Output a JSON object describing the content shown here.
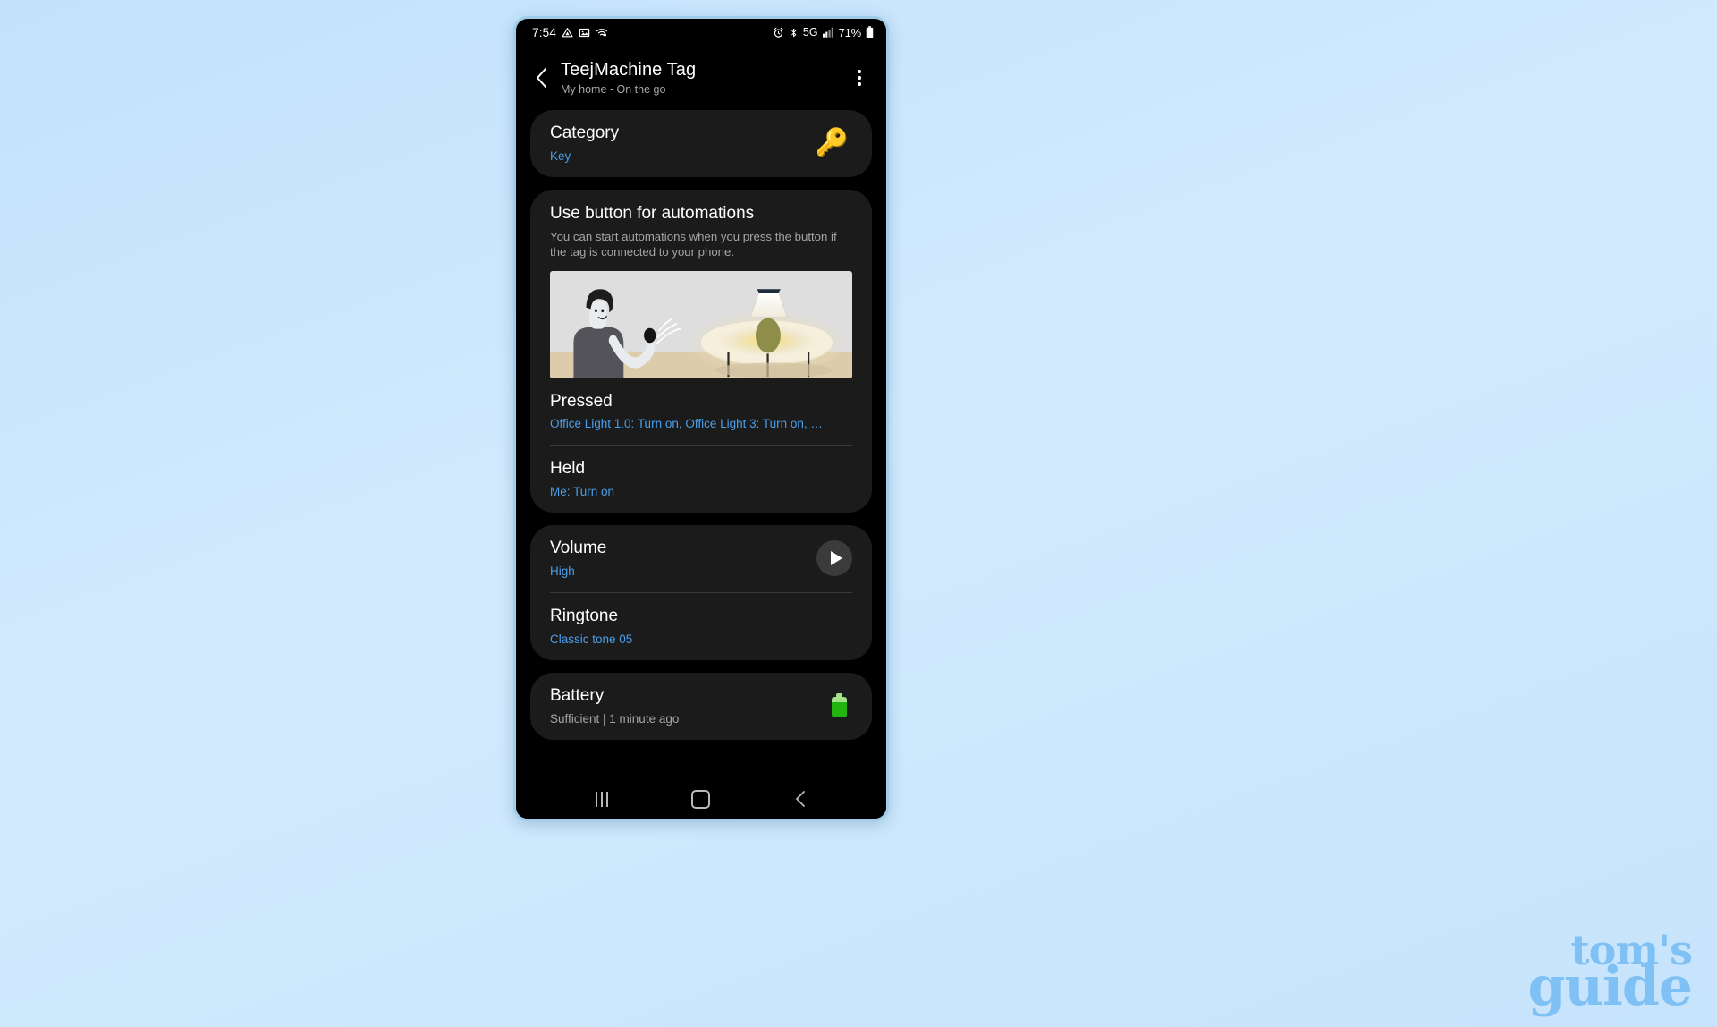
{
  "status_bar": {
    "clock": "7:54",
    "left_icons": [
      "drive-icon",
      "photo-icon",
      "wifi-icon"
    ],
    "right_icons": [
      "alarm-icon",
      "bluetooth-icon",
      "signal-bars-icon",
      "battery-icon"
    ],
    "network": "5G",
    "battery_percent": "71%"
  },
  "app_bar": {
    "back_icon": "chevron-left-icon",
    "title": "TeejMachine Tag",
    "subtitle": "My home - On the go",
    "menu_icon": "more-vertical-icon"
  },
  "category_card": {
    "title": "Category",
    "value": "Key",
    "icon": "key-emoji",
    "icon_glyph": "🔑"
  },
  "automations_card": {
    "title": "Use button for automations",
    "description": "You can start automations when you press the button if the tag is connected to your phone.",
    "illustration": "person-pressing-tag-turning-on-lamp",
    "rows": [
      {
        "title": "Pressed",
        "value": "Office Light 1.0: Turn on, Office Light 3: Turn on, …"
      },
      {
        "title": "Held",
        "value": "Me: Turn on"
      }
    ]
  },
  "sound_card": {
    "rows": [
      {
        "title": "Volume",
        "value": "High",
        "action_icon": "play-icon"
      },
      {
        "title": "Ringtone",
        "value": "Classic tone 05"
      }
    ]
  },
  "battery_card": {
    "title": "Battery",
    "status": "Sufficient  |  1 minute ago",
    "icon": "battery-full-green-icon"
  },
  "nav_bar": {
    "recents_label": "recents-icon",
    "home_label": "home-icon",
    "back_label": "back-icon"
  },
  "watermark": {
    "line1": "tom's",
    "line2": "guide"
  },
  "colors": {
    "accent_blue": "#4a9eea",
    "card_bg": "#1b1b1b",
    "screen_bg": "#000000",
    "page_bg": "#c8e5fd",
    "battery_green": "#22b512"
  }
}
